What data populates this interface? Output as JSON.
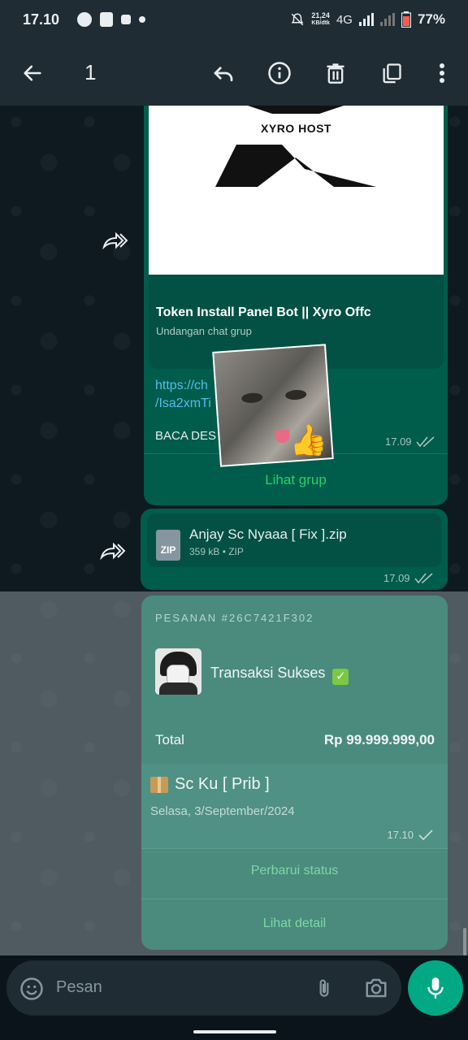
{
  "status_bar": {
    "time": "17.10",
    "net_speed_value": "21,24",
    "net_speed_unit": "KB/dtk",
    "network": "4G",
    "battery": "77%"
  },
  "toolbar": {
    "selected_count": "1",
    "icons": [
      "back-arrow-icon",
      "reply-icon",
      "info-icon",
      "delete-icon",
      "copy-icon",
      "more-icon"
    ]
  },
  "messages": {
    "link_message": {
      "logo_text": "XYRO HOST",
      "title": "Token Install Panel Bot || Xyro Offc",
      "subtitle": "Undangan chat grup",
      "url_line1": "https://ch",
      "url_line2": "/Isa2xmTi",
      "body": "BACA DES",
      "time": "17.09",
      "action": "Lihat grup"
    },
    "file_message": {
      "icon_label": "ZIP",
      "filename": "Anjay Sc Nyaaa [ Fix ].zip",
      "info": "359 kB • ZIP",
      "time": "17.09"
    },
    "order_message": {
      "header": "PESANAN #26C7421F302",
      "title": "Transaksi Sukses",
      "check": "✓",
      "total_label": "Total",
      "total_value": "Rp 99.999.999,00",
      "product": "Sc Ku [ Prib ]",
      "date": "Selasa, 3/September/2024",
      "time": "17.10",
      "action_update": "Perbarui status",
      "action_detail": "Lihat detail"
    }
  },
  "input": {
    "placeholder": "Pesan"
  },
  "colors": {
    "bubble_outgoing": "#005c4b",
    "accent": "#00a884",
    "link": "#53bdeb",
    "toolbar": "#1f2c34"
  }
}
